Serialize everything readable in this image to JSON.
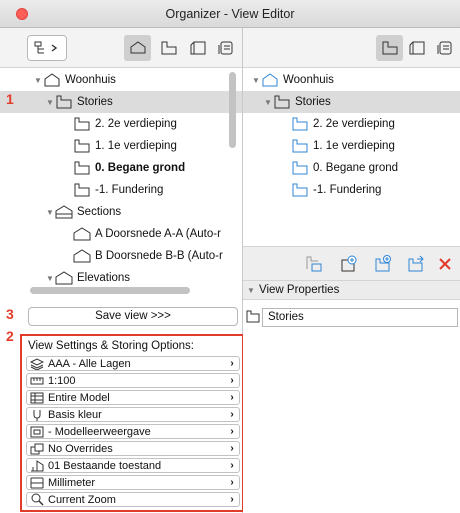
{
  "window": {
    "title": "Organizer - View Editor"
  },
  "left_tree": [
    {
      "label": "Woonhuis",
      "icon": "project-house-icon",
      "indent": 0,
      "expanded": true,
      "selected": false,
      "bold": false
    },
    {
      "label": "Stories",
      "icon": "stories-icon",
      "indent": 1,
      "expanded": true,
      "selected": true,
      "bold": false
    },
    {
      "label": "2. 2e verdieping",
      "icon": "story-icon",
      "indent": 2,
      "selected": false,
      "bold": false
    },
    {
      "label": "1. 1e verdieping",
      "icon": "story-icon",
      "indent": 2,
      "selected": false,
      "bold": false
    },
    {
      "label": "0. Begane grond",
      "icon": "story-icon",
      "indent": 2,
      "selected": false,
      "bold": true
    },
    {
      "label": "-1. Fundering",
      "icon": "story-icon",
      "indent": 2,
      "selected": false,
      "bold": false
    },
    {
      "label": "Sections",
      "icon": "sections-icon",
      "indent": 1,
      "expanded": true,
      "selected": false,
      "bold": false
    },
    {
      "label": "A Doorsnede A-A (Auto-r",
      "icon": "section-icon",
      "indent": 2,
      "selected": false,
      "bold": false
    },
    {
      "label": "B Doorsnede B-B (Auto-r",
      "icon": "section-icon",
      "indent": 2,
      "selected": false,
      "bold": false
    },
    {
      "label": "Elevations",
      "icon": "elevations-icon",
      "indent": 1,
      "expanded": true,
      "selected": false,
      "bold": false
    }
  ],
  "right_tree": [
    {
      "label": "Woonhuis",
      "icon": "project-house-icon",
      "indent": 0,
      "expanded": true,
      "selected": false
    },
    {
      "label": "Stories",
      "icon": "stories-icon",
      "indent": 1,
      "expanded": true,
      "selected": true
    },
    {
      "label": "2. 2e verdieping",
      "icon": "story-icon",
      "indent": 2,
      "selected": false
    },
    {
      "label": "1. 1e verdieping",
      "icon": "story-icon",
      "indent": 2,
      "selected": false
    },
    {
      "label": "0. Begane grond",
      "icon": "story-icon",
      "indent": 2,
      "selected": false
    },
    {
      "label": "-1. Fundering",
      "icon": "story-icon",
      "indent": 2,
      "selected": false
    }
  ],
  "save_view_label": "Save view >>>",
  "view_settings": {
    "header": "View Settings & Storing Options:",
    "options": [
      {
        "label": "AAA - Alle Lagen",
        "icon": "layers-icon"
      },
      {
        "label": "1:100",
        "icon": "scale-icon"
      },
      {
        "label": "Entire Model",
        "icon": "model-icon"
      },
      {
        "label": "Basis kleur",
        "icon": "pen-set-icon"
      },
      {
        "label": "- Modelleerweergave",
        "icon": "model-view-icon"
      },
      {
        "label": "No Overrides",
        "icon": "overrides-icon"
      },
      {
        "label": "01 Bestaande toestand",
        "icon": "renovation-icon"
      },
      {
        "label": "Millimeter",
        "icon": "dimension-icon"
      },
      {
        "label": "Current Zoom",
        "icon": "zoom-icon"
      }
    ]
  },
  "view_properties": {
    "header": "View Properties",
    "name_value": "Stories"
  },
  "annotations": [
    "1",
    "2",
    "3"
  ],
  "colors": {
    "accent_red": "#e23b2a",
    "icon_blue": "#2f86d6",
    "selection": "#dcdcdc"
  }
}
